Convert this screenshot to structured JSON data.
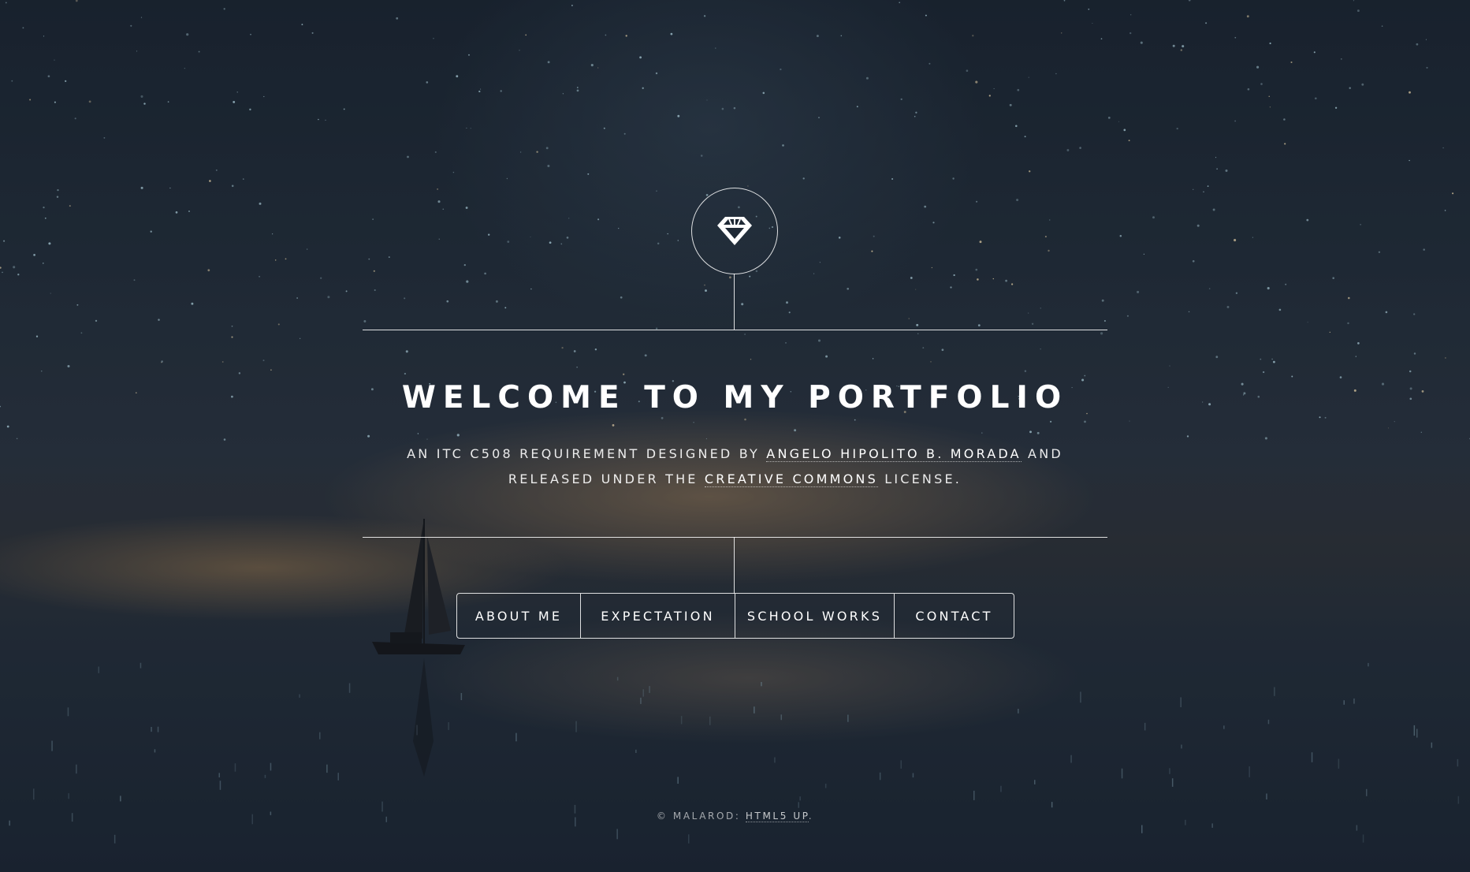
{
  "header": {
    "logo_icon": "diamond-icon",
    "title": "WELCOME TO MY PORTFOLIO",
    "subtitle": {
      "text_1": "AN ITC C508 REQUIREMENT DESIGNED BY ",
      "author_link": "ANGELO HIPOLITO B. MORADA",
      "text_2": " AND RELEASED UNDER THE ",
      "license_link": "CREATIVE COMMONS",
      "text_3": " LICENSE."
    }
  },
  "nav": {
    "items": [
      {
        "label": "ABOUT ME"
      },
      {
        "label": "EXPECTATION"
      },
      {
        "label": "SCHOOL WORKS"
      },
      {
        "label": "CONTACT"
      }
    ]
  },
  "footer": {
    "prefix": "© MALAROD: ",
    "link": "HTML5 UP",
    "suffix": "."
  },
  "background": {
    "description_icon": "night-sky-sailboat-image",
    "colors": {
      "sky": "#1a2431",
      "horizon": "#b48c5f",
      "water": "#1b2533"
    }
  }
}
